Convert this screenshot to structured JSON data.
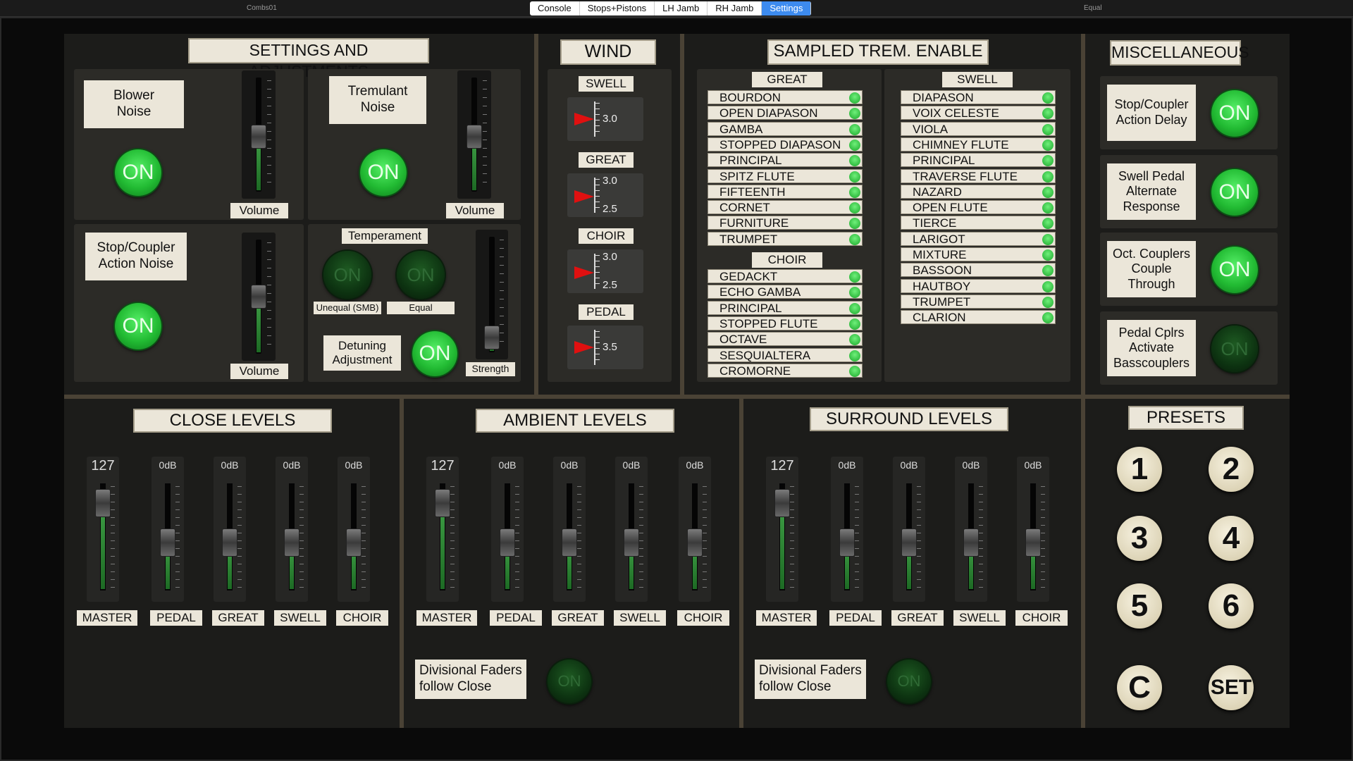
{
  "topbar": {
    "left_title": "Combs01",
    "right_title": "Equal",
    "tabs": [
      "Console",
      "Stops+Pistons",
      "LH Jamb",
      "RH Jamb",
      "Settings"
    ]
  },
  "settings": {
    "title": "SETTINGS AND ADJUSTMENTS",
    "blower_noise": "Blower\nNoise",
    "tremulant_noise": "Tremulant\nNoise",
    "stop_coupler_action_noise": "Stop/Coupler\nAction Noise",
    "volume": "Volume",
    "on": "ON",
    "temperament": "Temperament",
    "unequal": "Unequal (SMB)",
    "equal": "Equal",
    "detuning": "Detuning\nAdjustment",
    "strength": "Strength",
    "blower_volume": 0.48,
    "trem_volume": 0.48,
    "action_volume": 0.5,
    "detune_strength": 0.12
  },
  "wind": {
    "title": "WIND",
    "sections": [
      {
        "label": "SWELL",
        "top": "",
        "bottom": "",
        "mid": "3.0"
      },
      {
        "label": "GREAT",
        "top": "3.0",
        "bottom": "2.5",
        "mid": ""
      },
      {
        "label": "CHOIR",
        "top": "3.0",
        "bottom": "2.5",
        "mid": ""
      },
      {
        "label": "PEDAL",
        "top": "",
        "bottom": "",
        "mid": "3.5"
      }
    ]
  },
  "trem": {
    "title": "SAMPLED TREM. ENABLE",
    "great_label": "GREAT",
    "great": [
      "BOURDON",
      "OPEN DIAPASON",
      "GAMBA",
      "STOPPED DIAPASON",
      "PRINCIPAL",
      "SPITZ FLUTE",
      "FIFTEENTH",
      "CORNET",
      "FURNITURE",
      "TRUMPET"
    ],
    "choir_label": "CHOIR",
    "choir": [
      "GEDACKT",
      "ECHO GAMBA",
      "PRINCIPAL",
      "STOPPED FLUTE",
      "OCTAVE",
      "SESQUIALTERA",
      "CROMORNE"
    ],
    "swell_label": "SWELL",
    "swell": [
      "DIAPASON",
      "VOIX CELESTE",
      "VIOLA",
      "CHIMNEY FLUTE",
      "PRINCIPAL",
      "TRAVERSE FLUTE",
      "NAZARD",
      "OPEN FLUTE",
      "TIERCE",
      "LARIGOT",
      "MIXTURE",
      "BASSOON",
      "HAUTBOY",
      "TRUMPET",
      "CLARION"
    ]
  },
  "misc": {
    "title": "MISCELLANEOUS",
    "items": [
      {
        "label": "Stop/Coupler\nAction Delay",
        "state": "ON",
        "on": true
      },
      {
        "label": "Swell Pedal\nAlternate\nResponse",
        "state": "ON",
        "on": true
      },
      {
        "label": "Oct. Couplers\nCouple\nThrough",
        "state": "ON",
        "on": true
      },
      {
        "label": "Pedal Cplrs\nActivate\nBasscouplers",
        "state": "ON",
        "on": false
      }
    ]
  },
  "levels": {
    "close_title": "CLOSE LEVELS",
    "ambient_title": "AMBIENT LEVELS",
    "surround_title": "SURROUND LEVELS",
    "channels": [
      "MASTER",
      "PEDAL",
      "GREAT",
      "SWELL",
      "CHOIR"
    ],
    "values": [
      "127",
      "0dB",
      "0dB",
      "0dB",
      "0dB"
    ],
    "follow_label": "Divisional Faders\nfollow Close",
    "follow_state": "ON"
  },
  "presets": {
    "title": "PRESETS",
    "buttons": [
      "1",
      "2",
      "3",
      "4",
      "5",
      "6",
      "C",
      "SET"
    ]
  }
}
